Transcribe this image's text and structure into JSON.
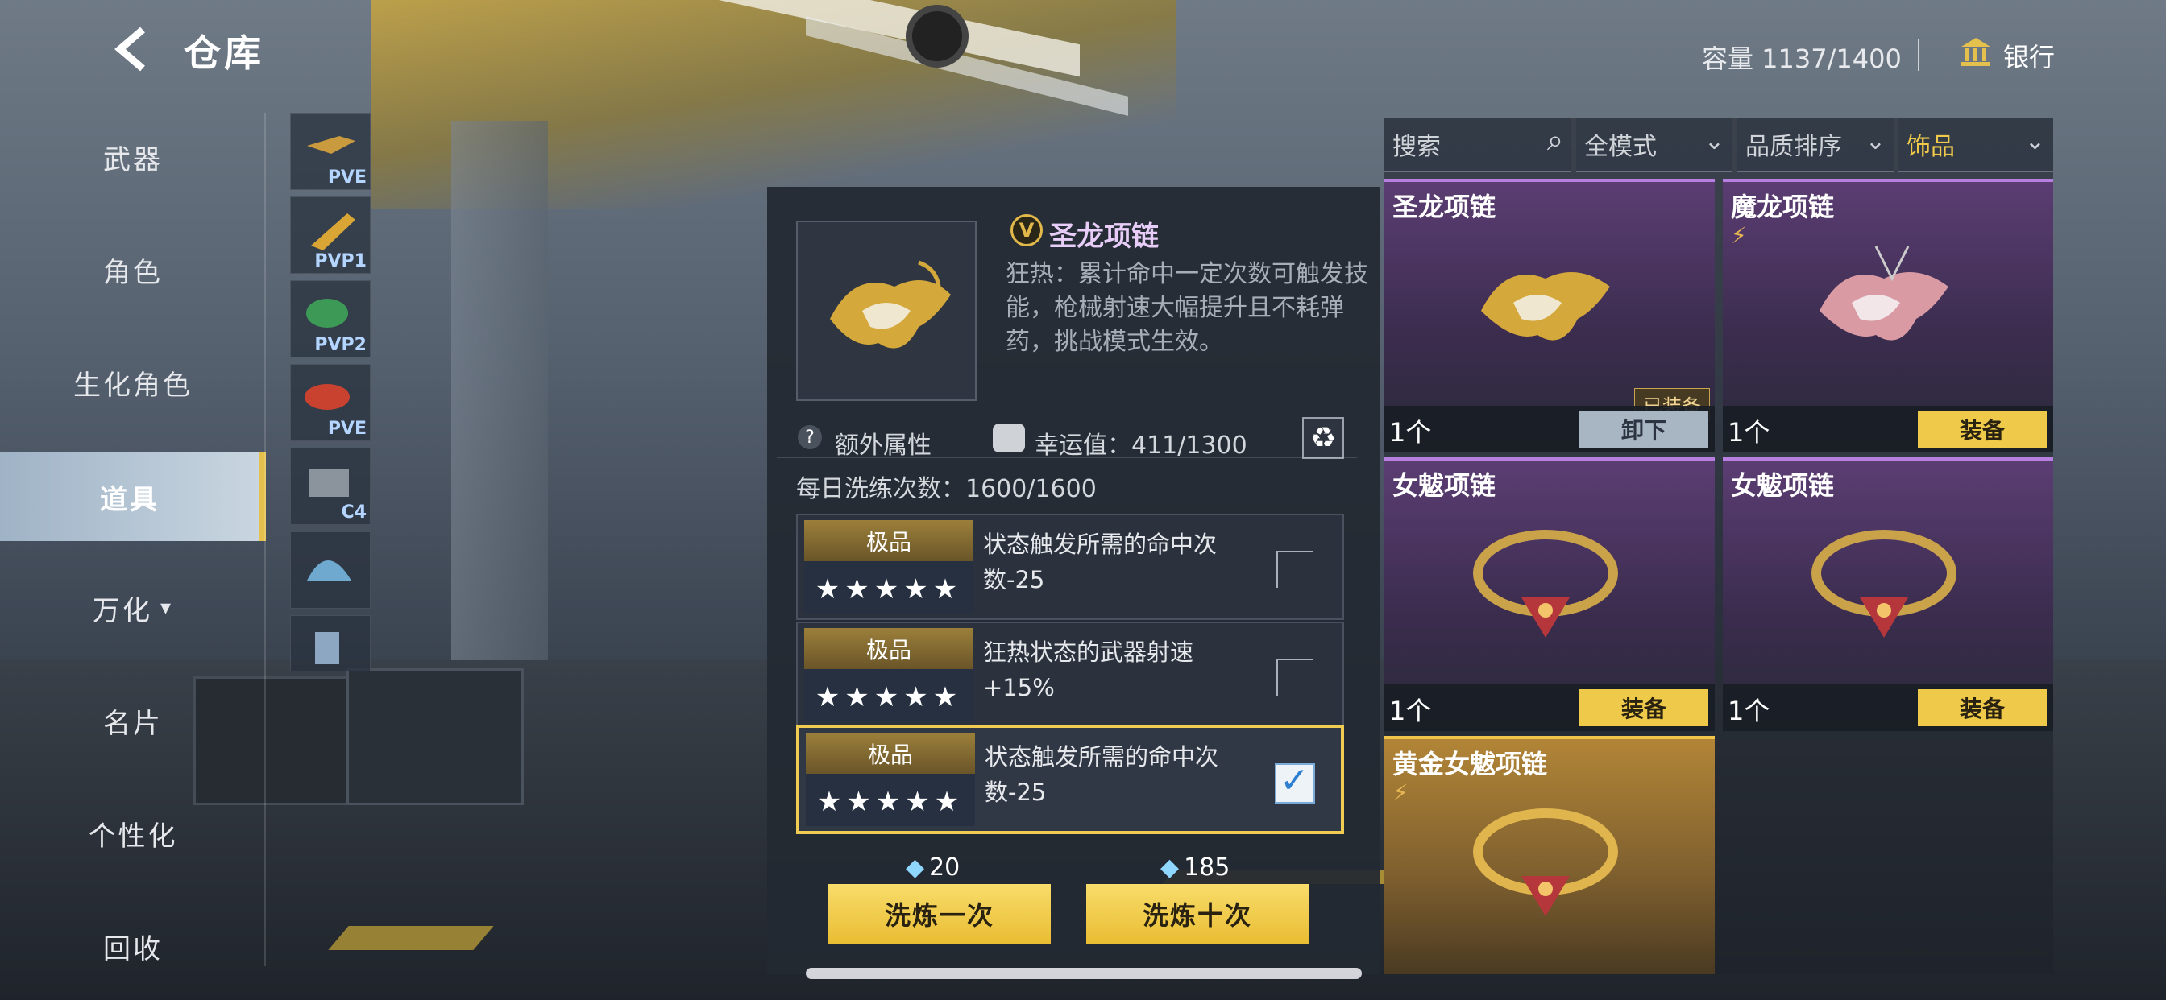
{
  "header": {
    "title": "仓库",
    "capacity": "容量 1137/1400",
    "bank": "银行"
  },
  "nav": {
    "items": [
      "武器",
      "角色",
      "生化角色",
      "道具",
      "万化",
      "名片",
      "个性化",
      "回收"
    ],
    "active": "道具",
    "arrow": "▾"
  },
  "sub_items": [
    {
      "tag": "PVE"
    },
    {
      "tag": "PVP1"
    },
    {
      "tag": "PVP2"
    },
    {
      "tag": "PVE"
    },
    {
      "tag": "C4"
    },
    {
      "tag": ""
    },
    {
      "tag": ""
    }
  ],
  "detail": {
    "name": "圣龙项链",
    "badge": "V",
    "desc": "狂热：累计命中一定次数可触发技能，枪械射速大幅提升且不耗弹药，挑战模式生效。",
    "extra_label": "额外属性",
    "extra_icon": "?",
    "luck_label": "幸运值：411/1300",
    "recycle_icon": "♻",
    "daily": "每日洗练次数：1600/1600",
    "attrs": [
      {
        "quality": "极品",
        "stars": "★★★★★",
        "text": "状态触发所需的命中次数-25",
        "selected": false
      },
      {
        "quality": "极品",
        "stars": "★★★★★",
        "text": "狂热状态的武器射速+15%",
        "selected": false
      },
      {
        "quality": "极品",
        "stars": "★★★★★",
        "text": "状态触发所需的命中次数-25",
        "selected": true
      }
    ],
    "check_mark": "✓",
    "gem_icon": "◆",
    "cost_once": "20",
    "cost_ten": "185",
    "btn_once": "洗炼一次",
    "btn_ten": "洗炼十次"
  },
  "filters": {
    "search_placeholder": "搜索",
    "search_icon": "⌕",
    "mode": "全模式",
    "sort": "品质排序",
    "category": "饰品",
    "dropdown": "⌄"
  },
  "cards": [
    {
      "name": "圣龙项链",
      "qty": "1个",
      "action": "卸下",
      "equipped": "已装备",
      "flag": ""
    },
    {
      "name": "魔龙项链",
      "qty": "1个",
      "action": "装备",
      "equipped": "",
      "flag": "⚡"
    },
    {
      "name": "女魃项链",
      "qty": "1个",
      "action": "装备",
      "equipped": "",
      "flag": ""
    },
    {
      "name": "女魃项链",
      "qty": "1个",
      "action": "装备",
      "equipped": "",
      "flag": ""
    },
    {
      "name": "黄金女魃项链",
      "qty": "1个",
      "action": "装备",
      "equipped": "",
      "flag": "⚡"
    }
  ],
  "colors": {
    "accent_gold": "#eec94a",
    "epic_purple": "#b67fe0",
    "active_nav": "#c9d6e1"
  }
}
